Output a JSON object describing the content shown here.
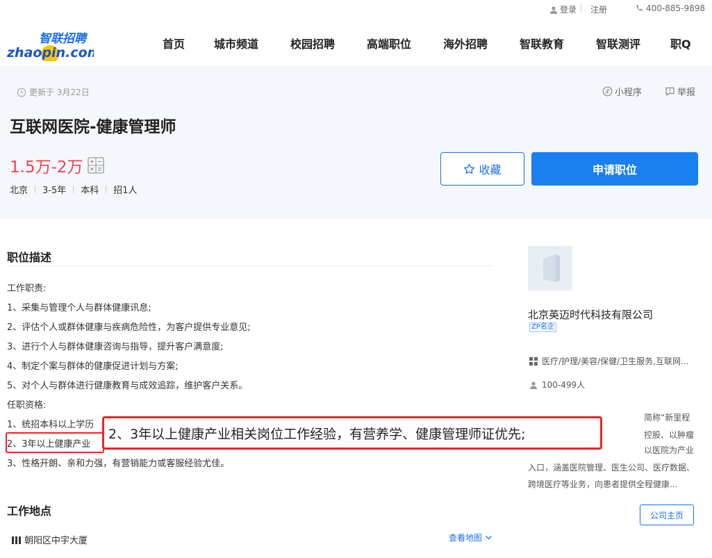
{
  "topbar": {
    "login": "登录",
    "register": "注册",
    "phone": "400-885-9898"
  },
  "logo": {
    "cn": "智联招聘",
    "en": "zhaopin.com"
  },
  "nav": [
    "首页",
    "城市频道",
    "校园招聘",
    "高端职位",
    "海外招聘",
    "智联教育",
    "智联测评",
    "职Q"
  ],
  "job": {
    "updated": "更新于 3月22日",
    "mini_program": "小程序",
    "report": "举报",
    "title": "互联网医院-健康管理师",
    "salary": "1.5万-2万",
    "tags": [
      "北京",
      "3-5年",
      "本科",
      "招1人"
    ],
    "favorite": "收藏",
    "apply": "申请职位"
  },
  "description": {
    "title": "职位描述",
    "lines": [
      "工作职责:",
      "1、采集与管理个人与群体健康讯息;",
      "2、评估个人或群体健康与疾病危险性，为客户提供专业意见;",
      "3、进行个人与群体健康咨询与指导，提升客户满意度;",
      "4、制定个案与群体的健康促进计划与方案;",
      "5、对个人与群体进行健康教育与成效追踪，维护客户关系。",
      "任职资格:",
      "1、统招本科以上学历",
      "2、3年以上健康产业",
      "3、性格开朗、亲和力强，有营销能力或客服经验尤佳。"
    ],
    "callout": "2、3年以上健康产业相关岗位工作经验，有营养学、健康管理师证优先;"
  },
  "location": {
    "title": "工作地点",
    "address": "朝阳区中宇大厦",
    "map_link": "查看地图"
  },
  "company": {
    "name": "北京英迈时代科技有限公司",
    "badge": "ZP名企",
    "industry": "医疗/护理/美容/保健/卫生服务,互联网...",
    "size": "100-499人",
    "intro": [
      "简称“新里程",
      "控股、以肿瘤",
      "以医院为产业",
      "入口，涵盖医院管理、医生公司、医疗数据、",
      "跨境医疗等业务，向患者提供全程健康..."
    ],
    "home_button": "公司主页"
  },
  "colors": {
    "brand_blue": "#1a7ff0",
    "salary_red": "#f0424e",
    "highlight_red": "#e8242a"
  }
}
